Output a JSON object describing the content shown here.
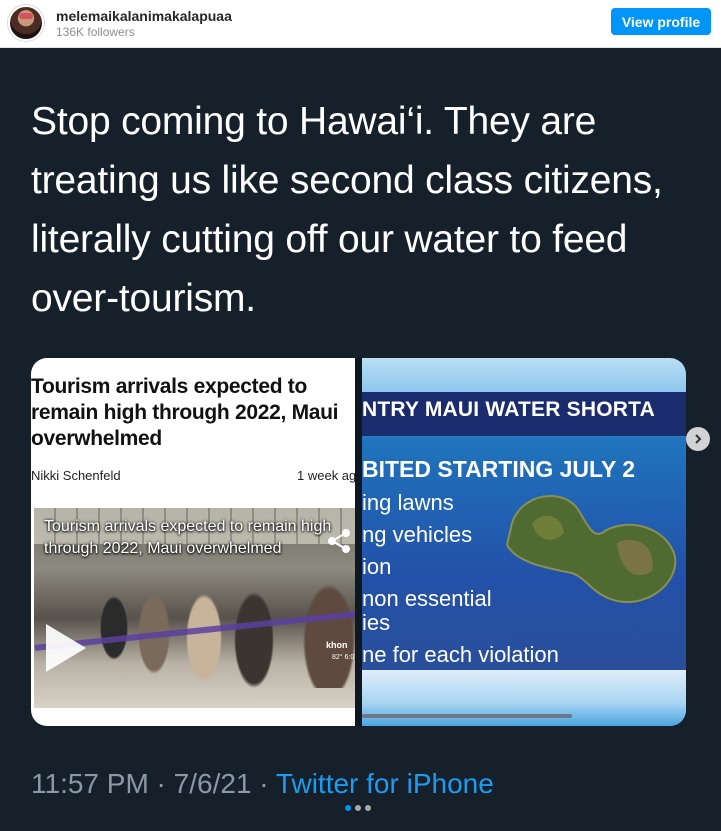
{
  "header": {
    "username": "melemaikalanimakalapuaa",
    "followers": "136K followers",
    "view_profile_label": "View profile"
  },
  "tweet": {
    "text": "Stop coming to Hawai‘i. They are treating us like second class citizens, literally cutting off our water to feed over-tourism.",
    "time": "11:57 PM",
    "separator": " · ",
    "date": "7/6/21",
    "source": "Twitter for iPhone"
  },
  "media": {
    "article": {
      "title": "Tourism arrivals expected to remain high through 2022, Maui overwhelmed",
      "author": "Nikki Schenfeld",
      "date": "1 week ag",
      "video_caption": "Tourism arrivals expected to remain high through 2022, Maui overwhelmed",
      "video_logo": "khon",
      "video_temp": "82°  6:0"
    },
    "news": {
      "band": "NTRY MAUI WATER SHORTA",
      "subheading": "BITED STARTING JULY 2",
      "lines": [
        "ing lawns",
        "ng vehicles",
        "ion",
        "non essential",
        "ies",
        "ne for each violation"
      ]
    }
  },
  "carousel": {
    "total": 3,
    "active_index": 0
  },
  "colors": {
    "card_background": "#15202b",
    "link_blue": "#1d9bf0",
    "button_blue": "#0095f6",
    "meta_gray": "#8b98a5"
  },
  "icons": [
    "avatar",
    "share-icon",
    "play-icon",
    "chevron-right-icon"
  ]
}
